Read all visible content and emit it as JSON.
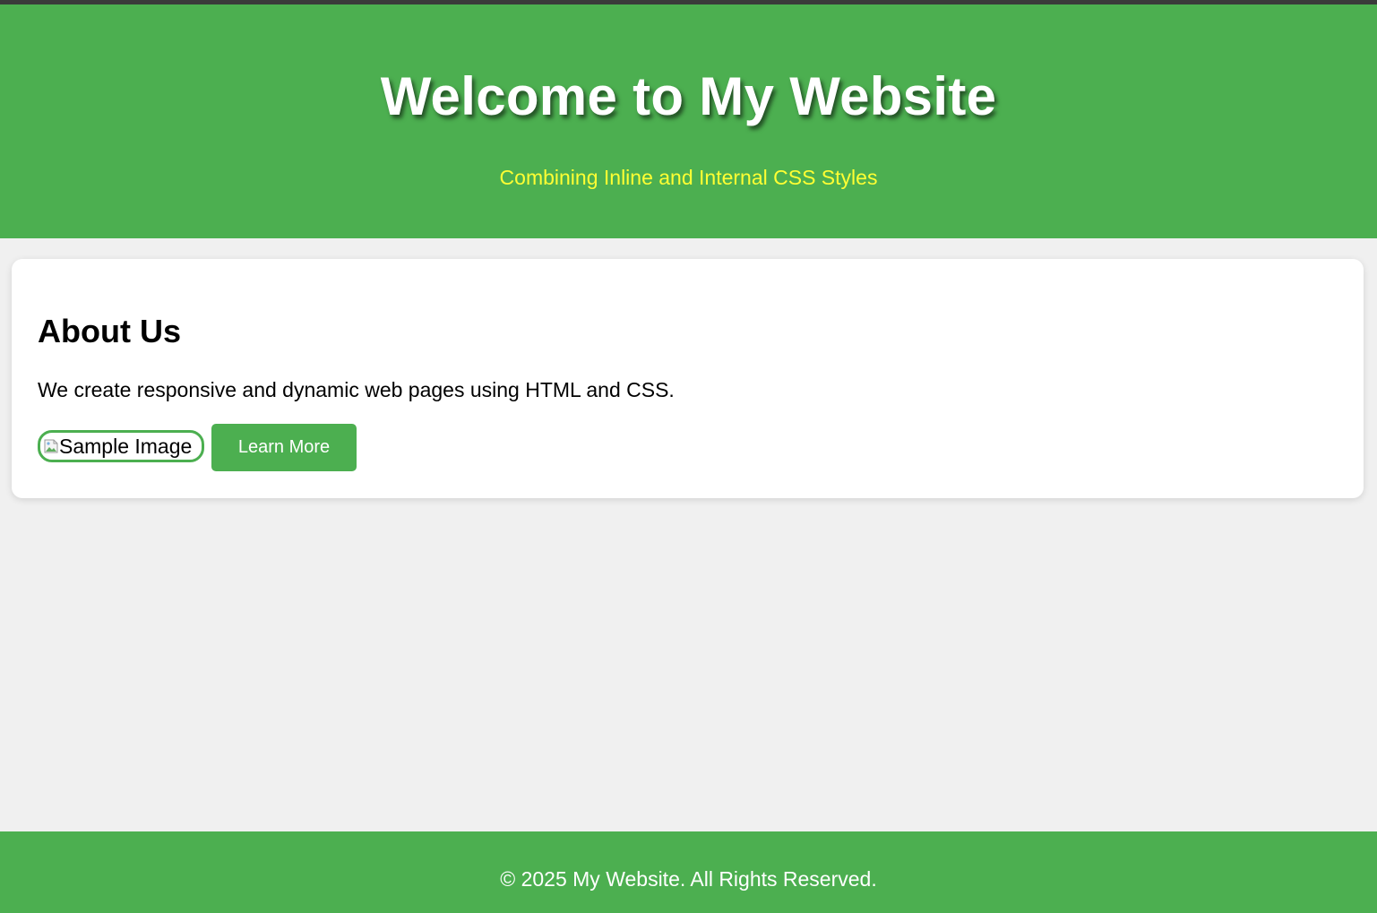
{
  "header": {
    "title": "Welcome to My Website",
    "subtitle": "Combining Inline and Internal CSS Styles"
  },
  "about": {
    "heading": "About Us",
    "description": "We create responsive and dynamic web pages using HTML and CSS.",
    "image_alt": "Sample Image",
    "button_label": "Learn More"
  },
  "footer": {
    "text": "© 2025 My Website. All Rights Reserved."
  },
  "colors": {
    "brand_green": "#4caf50",
    "subtitle_yellow": "#ffff33",
    "page_background": "#f0f0f0",
    "top_strip": "#3a3a3a"
  },
  "icons": {
    "image_placeholder": "broken-image-icon"
  }
}
